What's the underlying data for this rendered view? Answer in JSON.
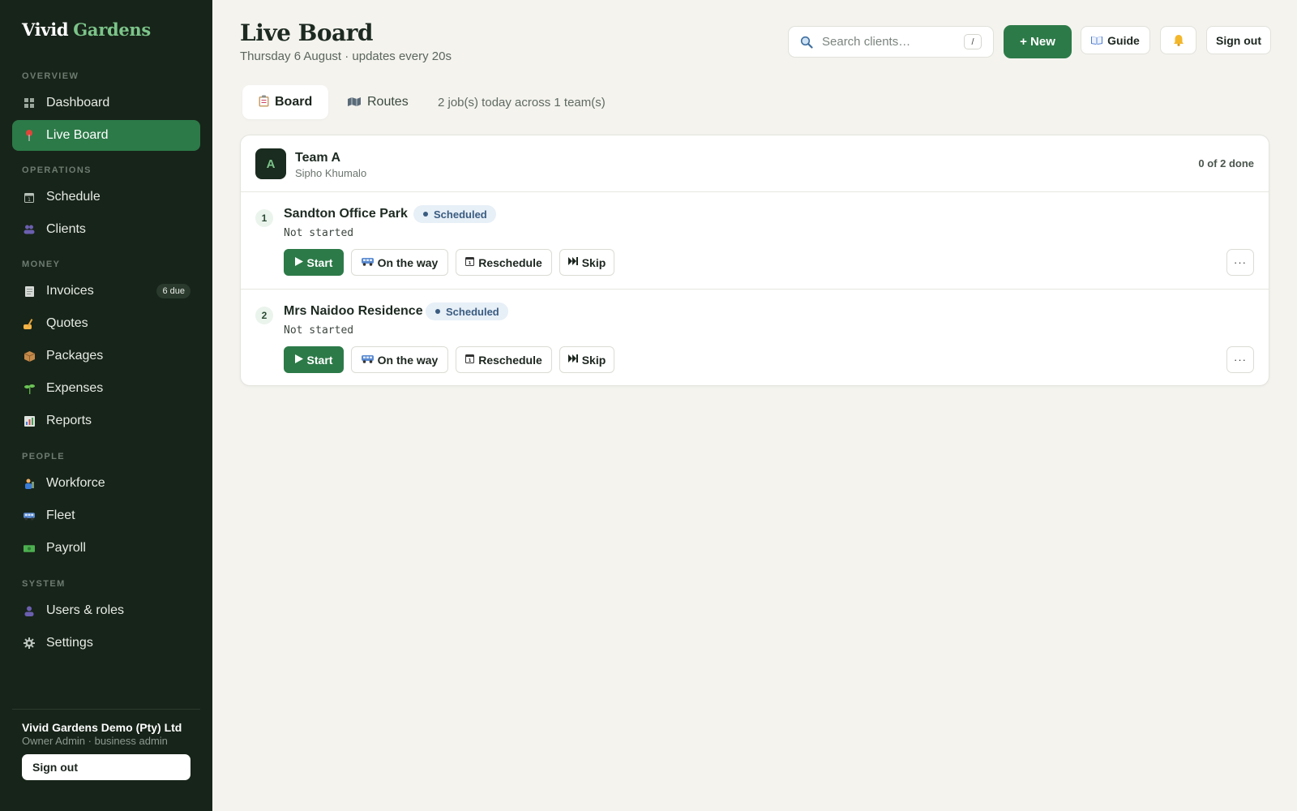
{
  "brand": {
    "part1": "Vivid",
    "part2": "Gardens"
  },
  "sidebar": {
    "sections": [
      {
        "label": "OVERVIEW"
      },
      {
        "label": "OPERATIONS"
      },
      {
        "label": "MONEY"
      },
      {
        "label": "PEOPLE"
      },
      {
        "label": "SYSTEM"
      }
    ],
    "items": [
      {
        "label": "Dashboard",
        "icon": "dashboard-icon",
        "active": false
      },
      {
        "label": "Live Board",
        "icon": "pin-icon",
        "active": true
      },
      {
        "label": "Schedule",
        "icon": "calendar-icon",
        "active": false
      },
      {
        "label": "Clients",
        "icon": "people-icon",
        "active": false
      },
      {
        "label": "Invoices",
        "icon": "receipt-icon",
        "active": false,
        "badge": "6 due"
      },
      {
        "label": "Quotes",
        "icon": "writing-hand-icon",
        "active": false
      },
      {
        "label": "Packages",
        "icon": "package-icon",
        "active": false
      },
      {
        "label": "Expenses",
        "icon": "seedling-icon",
        "active": false
      },
      {
        "label": "Reports",
        "icon": "bar-chart-icon",
        "active": false
      },
      {
        "label": "Workforce",
        "icon": "worker-icon",
        "active": false
      },
      {
        "label": "Fleet",
        "icon": "van-icon",
        "active": false
      },
      {
        "label": "Payroll",
        "icon": "money-icon",
        "active": false
      },
      {
        "label": "Users & roles",
        "icon": "user-icon",
        "active": false
      },
      {
        "label": "Settings",
        "icon": "gear-icon",
        "active": false
      }
    ],
    "org": {
      "name": "Vivid Gardens Demo (Pty) Ltd",
      "role": "Owner Admin · business admin"
    },
    "signout_label": "Sign out"
  },
  "header": {
    "title": "Live Board",
    "subtitle": "Thursday 6 August · updates every 20s",
    "search_placeholder": "Search clients…",
    "search_shortcut": "/",
    "new_label": "+ New",
    "guide_label": "Guide",
    "signout_label": "Sign out"
  },
  "tabs": [
    {
      "label": "Board",
      "icon": "clipboard-icon",
      "active": true
    },
    {
      "label": "Routes",
      "icon": "map-icon",
      "active": false
    }
  ],
  "jobs_summary": "2 job(s) today across 1 team(s)",
  "team": {
    "initial": "A",
    "name": "Team A",
    "lead": "Sipho Khumalo",
    "progress": "0 of 2 done",
    "jobs": [
      {
        "num": "1",
        "name": "Sandton Office Park",
        "status": "Scheduled",
        "state": "Not started",
        "actions": {
          "start": "Start",
          "on_the_way": "On the way",
          "reschedule": "Reschedule",
          "skip": "Skip"
        },
        "more": "···"
      },
      {
        "num": "2",
        "name": "Mrs Naidoo Residence",
        "status": "Scheduled",
        "state": "Not started",
        "actions": {
          "start": "Start",
          "on_the_way": "On the way",
          "reschedule": "Reschedule",
          "skip": "Skip"
        },
        "more": "···"
      }
    ]
  },
  "colors": {
    "sidebar_bg": "#172419",
    "accent": "#2c7a48",
    "brand_accent": "#7cc48a",
    "page_bg": "#f4f3ee",
    "status_pill_bg": "#e7eff7",
    "status_pill_text": "#3a5c80"
  }
}
